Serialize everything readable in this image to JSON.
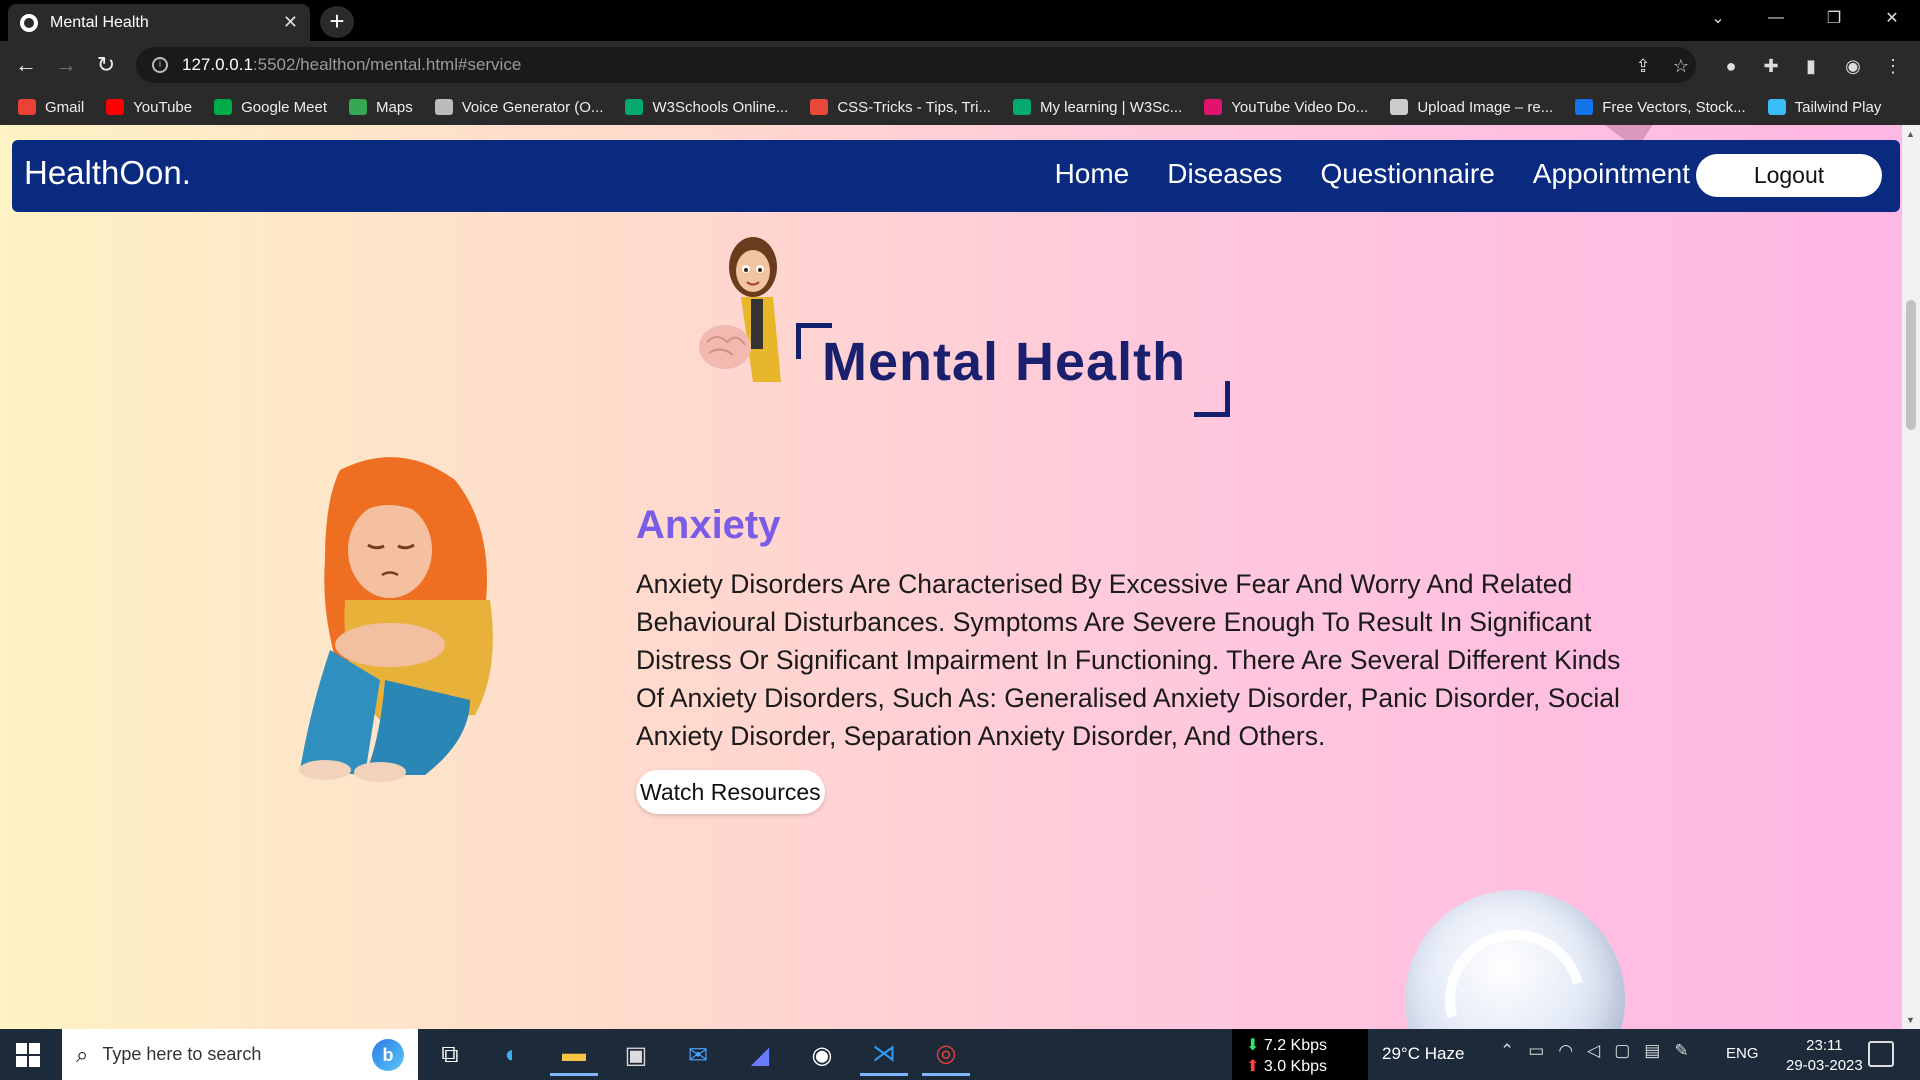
{
  "browser": {
    "tab_title": "Mental Health",
    "tab_close": "✕",
    "new_tab": "+",
    "url_host": "127.0.0.1",
    "url_rest": ":5502/healthon/mental.html#service",
    "bookmarks": [
      {
        "label": "Gmail",
        "icon": "gmail-icon",
        "color": "#ea4335"
      },
      {
        "label": "YouTube",
        "icon": "youtube-icon",
        "color": "#ff0000"
      },
      {
        "label": "Google Meet",
        "icon": "google-meet-icon",
        "color": "#00ac47"
      },
      {
        "label": "Maps",
        "icon": "maps-icon",
        "color": "#34a853"
      },
      {
        "label": "Voice Generator (O...",
        "icon": "voice-generator-icon",
        "color": "#bbbbbb"
      },
      {
        "label": "W3Schools Online...",
        "icon": "w3schools-icon",
        "color": "#04aa6d"
      },
      {
        "label": "CSS-Tricks - Tips, Tri...",
        "icon": "css-tricks-icon",
        "color": "#e8493a"
      },
      {
        "label": "My learning | W3Sc...",
        "icon": "w3schools-icon",
        "color": "#04aa6d"
      },
      {
        "label": "YouTube Video Do...",
        "icon": "video-downloader-icon",
        "color": "#e0146c"
      },
      {
        "label": "Upload Image – re...",
        "icon": "upload-image-icon",
        "color": "#cccccc"
      },
      {
        "label": "Free Vectors, Stock...",
        "icon": "freepik-icon",
        "color": "#1273eb"
      },
      {
        "label": "Tailwind Play",
        "icon": "tailwind-icon",
        "color": "#38bdf8"
      }
    ]
  },
  "site": {
    "brand": "HealthOon.",
    "nav": [
      "Home",
      "Diseases",
      "Questionnaire",
      "Appointment"
    ],
    "logout": "Logout",
    "heading": "Mental Health",
    "section": {
      "title": "Anxiety",
      "description": "Anxiety Disorders Are Characterised By Excessive Fear And Worry And Related Behavioural Disturbances. Symptoms Are Severe Enough To Result In Significant Distress Or Significant Impairment In Functioning. There Are Several Different Kinds Of Anxiety Disorders, Such As: Generalised Anxiety Disorder, Panic Disorder, Social Anxiety Disorder, Separation Anxiety Disorder, And Others.",
      "button": "Watch Resources"
    },
    "colors": {
      "navbar": "#0a2a80",
      "heading": "#1a1f6e",
      "section_title": "#7a5ce6"
    }
  },
  "taskbar": {
    "search_placeholder": "Type here to search",
    "net_down": "7.2 Kbps",
    "net_up": "3.0 Kbps",
    "weather": "29°C  Haze",
    "language": "ENG",
    "time": "23:11",
    "date": "29-03-2023"
  }
}
